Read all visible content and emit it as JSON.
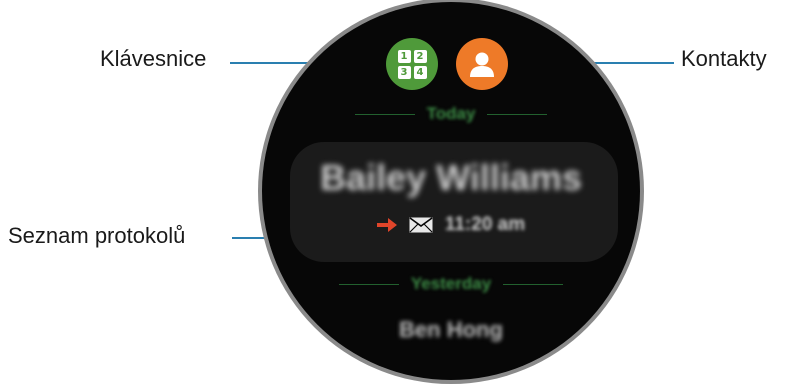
{
  "callouts": {
    "keypad": "Klávesnice",
    "contacts": "Kontakty",
    "log_list": "Seznam protokolů"
  },
  "watch": {
    "buttons": [
      {
        "icon": "keypad-icon",
        "digits": [
          "1",
          "2",
          "3",
          "4"
        ],
        "color": "#4f9a3a"
      },
      {
        "icon": "contact-icon",
        "color": "#ee7a28"
      }
    ],
    "sections": [
      {
        "header": "Today",
        "entries": [
          {
            "name": "Bailey Williams",
            "direction_icon": "outgoing-arrow-icon",
            "type_icon": "message-icon",
            "time": "11:20 am"
          }
        ]
      },
      {
        "header": "Yesterday",
        "entries": [
          {
            "name": "Ben Hong"
          }
        ]
      }
    ]
  },
  "colors": {
    "callout_line": "#2a7fb0",
    "accent_green": "#3d8d46",
    "arrow": "#e0452a"
  }
}
